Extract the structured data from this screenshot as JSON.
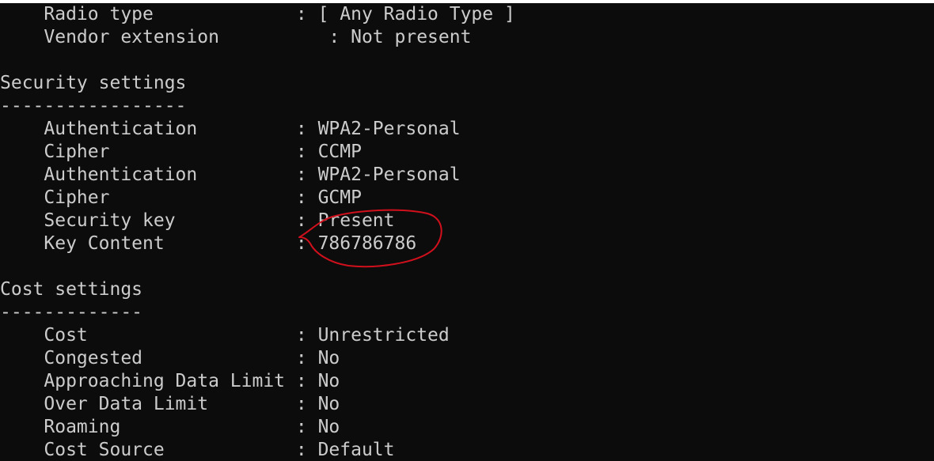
{
  "console": {
    "lines": [
      {
        "text": "    Radio type             : [ Any Radio Type ]"
      },
      {
        "text": "    Vendor extension          : Not present"
      },
      {
        "text": ""
      },
      {
        "text": "Security settings"
      },
      {
        "text": "-----------------"
      },
      {
        "text": "    Authentication         : WPA2-Personal"
      },
      {
        "text": "    Cipher                 : CCMP"
      },
      {
        "text": "    Authentication         : WPA2-Personal"
      },
      {
        "text": "    Cipher                 : GCMP"
      },
      {
        "text": "    Security key           : Present"
      },
      {
        "text": "    Key Content            : 786786786"
      },
      {
        "text": ""
      },
      {
        "text": "Cost settings"
      },
      {
        "text": "-------------"
      },
      {
        "text": "    Cost                   : Unrestricted"
      },
      {
        "text": "    Congested              : No"
      },
      {
        "text": "    Approaching Data Limit : No"
      },
      {
        "text": "    Over Data Limit        : No"
      },
      {
        "text": "    Roaming                : No"
      },
      {
        "text": "    Cost Source            : Default"
      }
    ]
  },
  "colors": {
    "background": "#0c0c0c",
    "text": "#cccccc",
    "annotation": "#d0101c"
  }
}
